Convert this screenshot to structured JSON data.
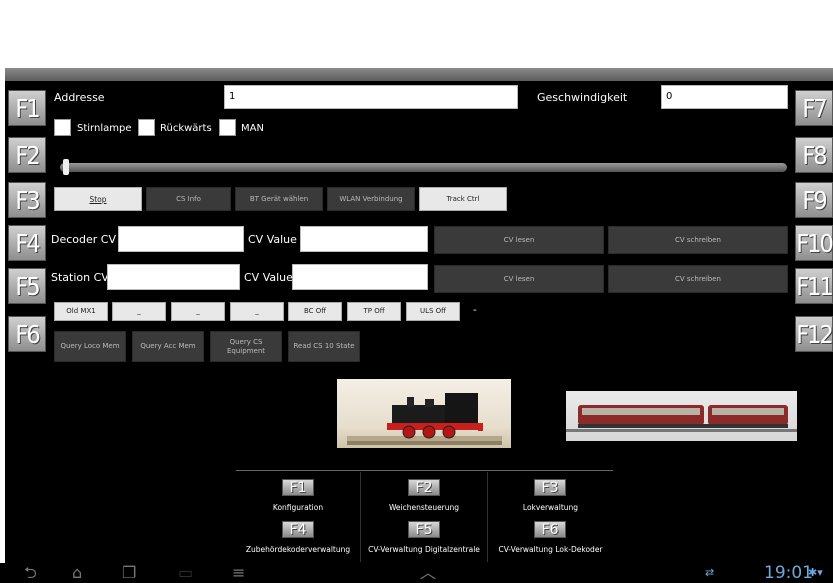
{
  "fkeys": {
    "f1": "F1",
    "f2": "F2",
    "f3": "F3",
    "f4": "F4",
    "f5": "F5",
    "f6": "F6",
    "f7": "F7",
    "f8": "F8",
    "f9": "F9",
    "f10": "F10",
    "f11": "F11",
    "f12": "F12"
  },
  "address": {
    "label": "Addresse",
    "value": "1"
  },
  "speed": {
    "label": "Geschwindigkeit",
    "value": "0",
    "slider_fraction": 0.0
  },
  "checkboxes": {
    "front_light": "Stirnlampe",
    "reverse": "Rückwärts",
    "man": "MAN"
  },
  "buttons_row1": {
    "stop": "Stop",
    "cs_info": "CS Info",
    "bt": "BT Gerät wählen",
    "wlan": "WLAN Verbindung",
    "track": "Track Ctrl"
  },
  "decoder": {
    "label": "Decoder CV",
    "value": "",
    "cv_value_label": "CV Value",
    "cv_value": "",
    "read": "CV lesen",
    "write": "CV schreiben"
  },
  "station": {
    "label": "Station CV",
    "value": "",
    "cv_value_label": "CV Value",
    "cv_value": "",
    "read": "CV lesen",
    "write": "CV schreiben"
  },
  "buttons_row2": {
    "old_mx1": "Old MX1",
    "b1": "_",
    "b2": "_",
    "b3": "_",
    "bc": "BC Off",
    "tp": "TP Off",
    "uls": "ULS Off",
    "dash": "-"
  },
  "buttons_row3": {
    "query_loco": "Query Loco Mem",
    "query_acc": "Query Acc Mem",
    "query_cs": "Query CS Equipment",
    "read_cs10": "Read CS 10 State"
  },
  "menu": [
    {
      "key": "F1",
      "label": "Konfiguration"
    },
    {
      "key": "F2",
      "label": "Weichensteuerung"
    },
    {
      "key": "F3",
      "label": "Lokverwaltung"
    },
    {
      "key": "F4",
      "label": "Zubehördekoderverwaltung"
    },
    {
      "key": "F5",
      "label": "CV-Verwaltung Digitalzentrale"
    },
    {
      "key": "F6",
      "label": "CV-Verwaltung Lok-Dekoder"
    }
  ],
  "statusbar": {
    "clock": "19:01"
  },
  "colors": {
    "background": "#000000",
    "accent": "#6fa8dc"
  }
}
